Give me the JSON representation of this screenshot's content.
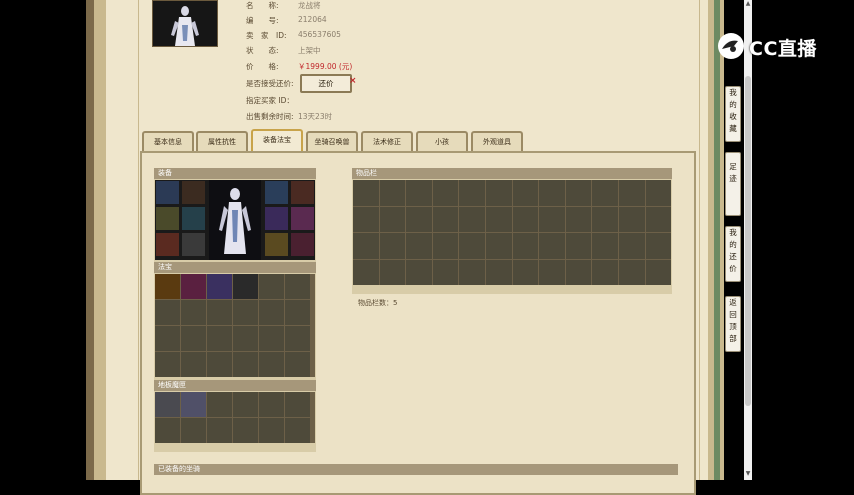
{
  "item": {
    "name_label": "名　　称:",
    "name_value": "龙战将",
    "id_label": "编　　号:",
    "id_value": "212064",
    "seller_label": "卖　家　ID:",
    "seller_value": "456537605",
    "status_label": "状　　态:",
    "status_value": "上架中",
    "price_label": "价　　格:",
    "price_value": "￥1999.00 (元)",
    "accept_bid_label": "是否接受还价:",
    "bid_button": "还价",
    "buyer_label": "指定买家 ID：",
    "buyer_value": "",
    "remain_label": "出售剩余时间:",
    "remain_value": "13天23时"
  },
  "tabs": [
    "基本信息",
    "属性抗性",
    "装备法宝",
    "坐骑召唤兽",
    "法术修正",
    "小孩",
    "外观道具"
  ],
  "active_tab": 2,
  "sections": {
    "equipment": "装备",
    "treasure": "法宝",
    "ground_wand": "地板魔匣",
    "inventory": "物品栏",
    "inventory_count": "物品栏数：5",
    "next_section": "已装备的坐骑"
  },
  "sidebar": {
    "favorites": "我的收藏",
    "footprint": "足迹",
    "my_bids": "我的还价",
    "back_top": "返回顶部"
  },
  "logo": "CC直播",
  "colors": {
    "price": "#c0262a",
    "panel_header": "#a6977a",
    "cell": "#4e4a3a"
  }
}
